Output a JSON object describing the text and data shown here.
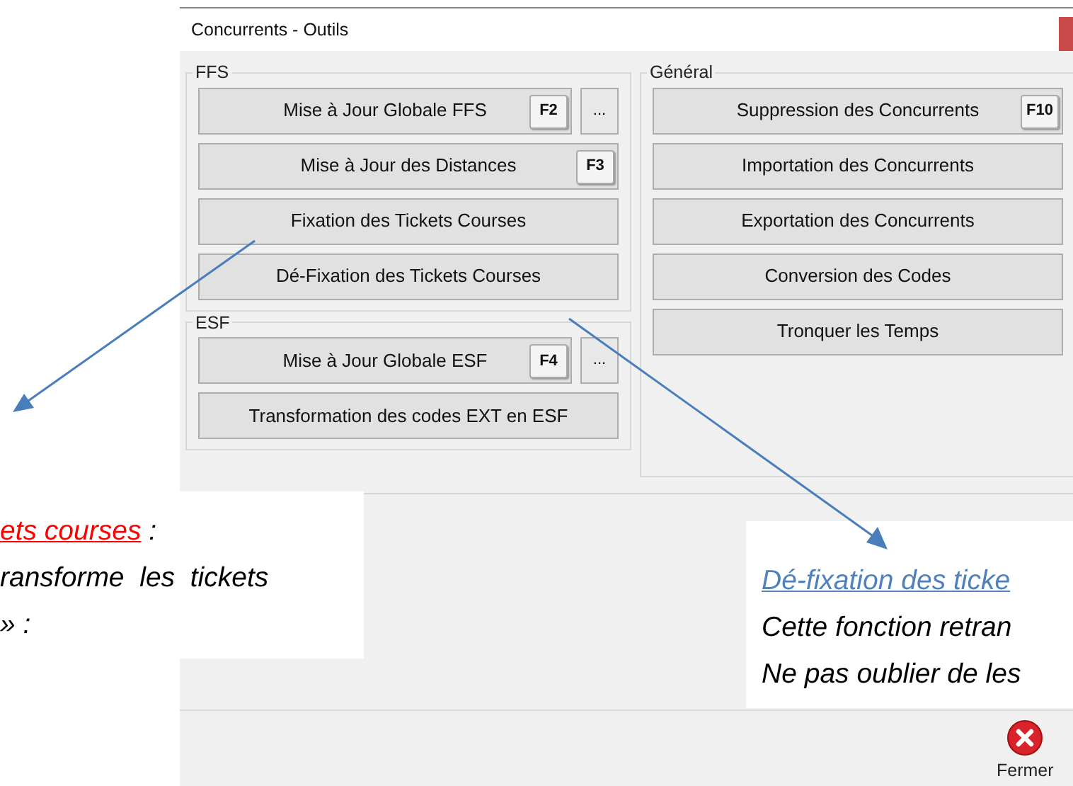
{
  "window": {
    "title": "Concurrents - Outils"
  },
  "groups": [
    {
      "title": "FFS",
      "buttons": [
        {
          "label": "Mise à Jour Globale FFS",
          "shortcut": "F2",
          "more": "..."
        },
        {
          "label": "Mise à Jour des Distances",
          "shortcut": "F3"
        },
        {
          "label": "Fixation des Tickets Courses"
        },
        {
          "label": "Dé-Fixation des Tickets Courses"
        }
      ]
    },
    {
      "title": "ESF",
      "buttons": [
        {
          "label": "Mise à Jour Globale ESF",
          "shortcut": "F4",
          "more": "..."
        },
        {
          "label": "Transformation des codes EXT en ESF"
        }
      ]
    },
    {
      "title": "Général",
      "buttons": [
        {
          "label": "Suppression des Concurrents",
          "shortcut": "F10"
        },
        {
          "label": "Importation des Concurrents"
        },
        {
          "label": "Exportation des Concurrents"
        },
        {
          "label": "Conversion des Codes"
        },
        {
          "label": "Tronquer les Temps"
        }
      ]
    }
  ],
  "footer": {
    "close_label": "Fermer"
  },
  "notes": [
    {
      "heading": "ets courses",
      "heading_suffix": " :",
      "color": "#ff0000",
      "lines": [
        "ransforme  les  tickets",
        "» :"
      ]
    },
    {
      "heading": "Dé-fixation des ticke",
      "color": "#4f81bd",
      "lines": [
        "Cette fonction retran",
        "Ne pas oublier de les"
      ]
    }
  ]
}
